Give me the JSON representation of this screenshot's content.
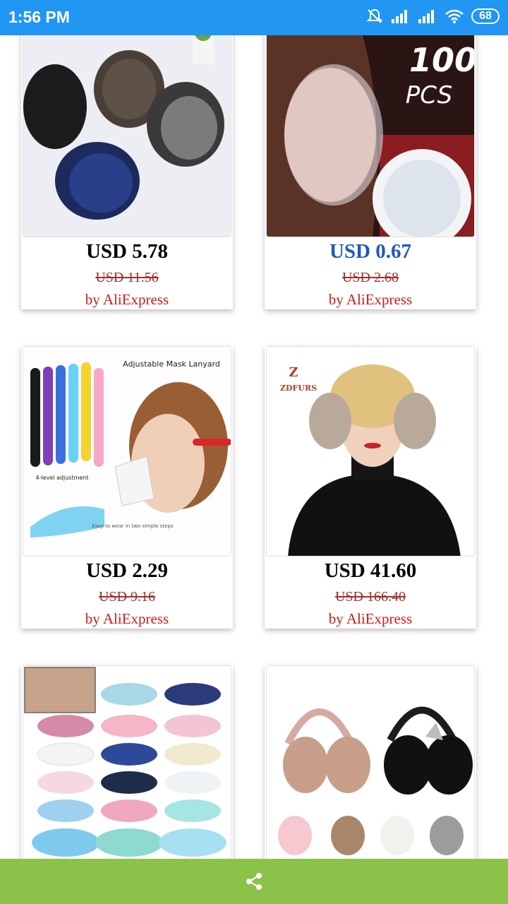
{
  "status_bar": {
    "time": "1:56 PM",
    "battery": "68",
    "icons": [
      "mute-icon",
      "signal-icon",
      "signal-icon",
      "wifi-icon",
      "battery-icon"
    ]
  },
  "products": [
    {
      "price": "USD 5.78",
      "old_price": "USD 11.56",
      "vendor": "by AliExpress",
      "image": "earmuffs-gray-blue"
    },
    {
      "price": "USD 0.67",
      "old_price": "USD 2.68",
      "vendor": "by AliExpress",
      "image": "ear-covers",
      "image_text": {
        "line1": "100",
        "line2": "PCS"
      }
    },
    {
      "price": "USD 2.29",
      "old_price": "USD 9.16",
      "vendor": "by AliExpress",
      "image": "mask-lanyard",
      "image_text": {
        "title": "Adjustable Mask Lanyard",
        "caption1": "4-level adjustment",
        "caption2": "Easy to wear in two simple steps"
      }
    },
    {
      "price": "USD 41.60",
      "old_price": "USD 166.40",
      "vendor": "by AliExpress",
      "image": "fur-earmuffs",
      "image_text": {
        "brand": "ZDFURS"
      }
    },
    {
      "price": "",
      "old_price": "",
      "vendor": "",
      "image": "sleep-masks"
    },
    {
      "price": "",
      "old_price": "",
      "vendor": "",
      "image": "cat-ear-earmuffs"
    }
  ],
  "bottom_bar": {
    "icon": "share-icon"
  },
  "colors": {
    "status_bar": "#2196F3",
    "bottom_bar": "#8bc34a",
    "price_highlight": "#1e5bb8",
    "vendor": "#d01a1a",
    "old_price": "#a0312c"
  }
}
